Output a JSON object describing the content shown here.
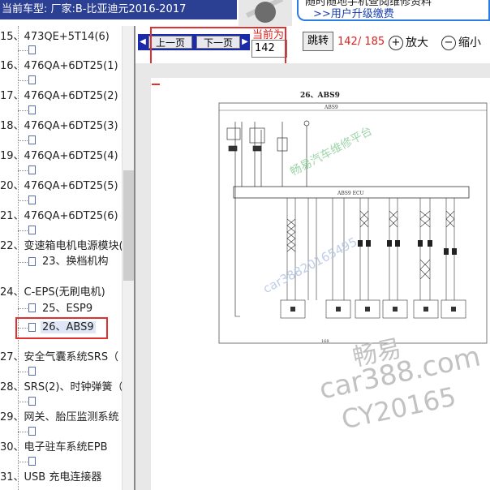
{
  "header": {
    "title": "当前车型:  厂家:B-比亚迪元2016-2017",
    "promo_line1": "随时随地手机查阅维修资料",
    "promo_line2": ">>用户升级缴费"
  },
  "tree": {
    "items": [
      {
        "label": "15、473QE+5T14(6)"
      },
      {
        "label": "16、476QA+6DT25(1)"
      },
      {
        "label": "17、476QA+6DT25(2)"
      },
      {
        "label": "18、476QA+6DT25(3)"
      },
      {
        "label": "19、476QA+6DT25(4)"
      },
      {
        "label": "20、476QA+6DT25(5)"
      },
      {
        "label": "21、476QA+6DT25(6)"
      },
      {
        "label": "22、变速箱电机电源模块("
      },
      {
        "label": "23、换档机构"
      },
      {
        "label": "24、C-EPS(无刷电机)"
      },
      {
        "label": "25、ESP9"
      },
      {
        "label": "26、ABS9"
      },
      {
        "label": "27、安全气囊系统SRS（"
      },
      {
        "label": "28、SRS(2)、时钟弹簧（"
      },
      {
        "label": "29、网关、胎压监测系统"
      },
      {
        "label": "30、电子驻车系统EPB"
      },
      {
        "label": "31、USB 充电连接器"
      }
    ]
  },
  "toolbar": {
    "prev_label": "上一页",
    "next_label": "下一页",
    "current_label": "当前为",
    "current_page": "142",
    "jump_label": "跳转",
    "page_count": "142/ 185",
    "zoom_in_label": "放大",
    "zoom_out_label": "缩小"
  },
  "document": {
    "page_title": "26、ABS9",
    "box_label": "ABS9",
    "ecu_label": "ABS9  ECU",
    "page_number": "168",
    "watermark_green": "畅易汽车维修平台",
    "watermark_blue": "car38820165495",
    "watermark_line1": "畅易",
    "watermark_line2": "car388.com",
    "watermark_line3": "CY20165"
  },
  "colors": {
    "title_bar": "#2b3f93",
    "highlight_red": "#e03030",
    "nav_blue": "#1a2aa8",
    "page_count_red": "#e0201f"
  }
}
